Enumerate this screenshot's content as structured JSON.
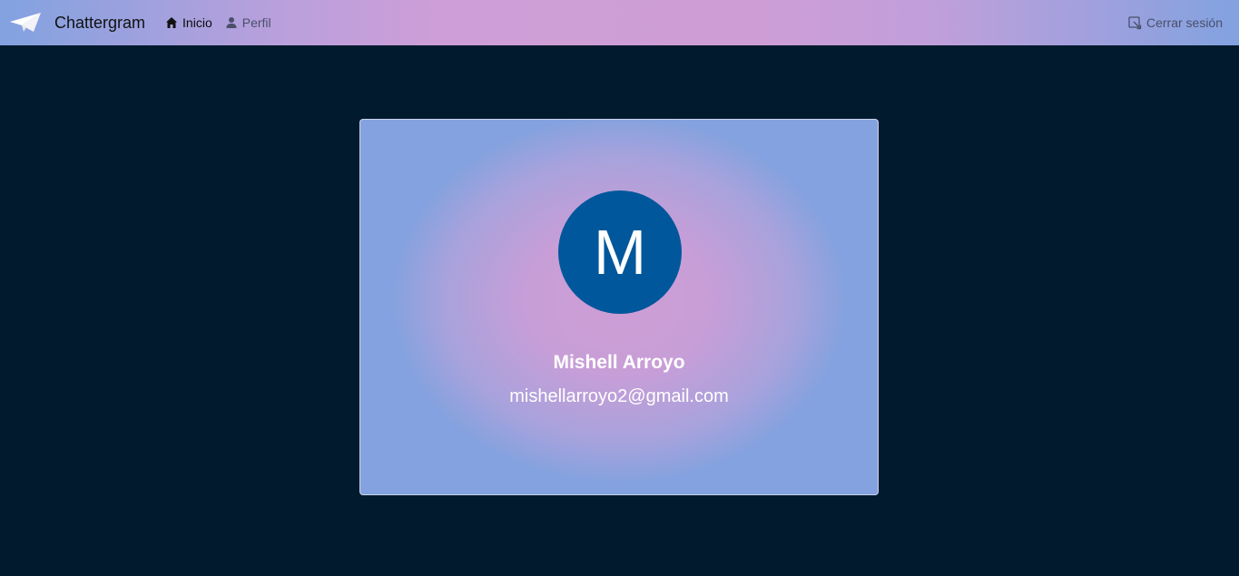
{
  "navbar": {
    "brand": "Chattergram",
    "brand_icon": "paper-plane-icon",
    "links": [
      {
        "label": "Inicio",
        "icon": "home-icon",
        "active": true
      },
      {
        "label": "Perfil",
        "icon": "user-icon",
        "active": false
      }
    ],
    "logout": {
      "label": "Cerrar sesión",
      "icon": "logout-icon"
    }
  },
  "profile": {
    "avatar_initial": "M",
    "name": "Mishell Arroyo",
    "email": "mishellarroyo2@gmail.com"
  },
  "colors": {
    "background": "#021a2d",
    "avatar": "#01579b",
    "gradient_blue": "#83a2df",
    "gradient_pink": "#cf9dd6"
  }
}
